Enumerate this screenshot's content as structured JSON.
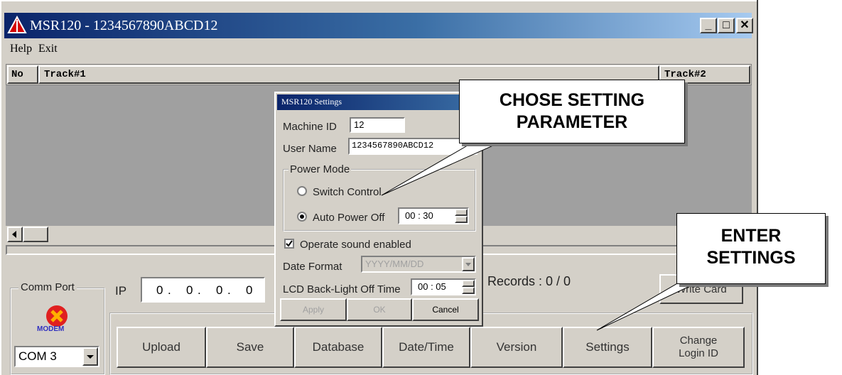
{
  "window": {
    "title": "MSR120 - 1234567890ABCD12",
    "controls": {
      "minimize": "_",
      "maximize": "□",
      "close": "✕"
    }
  },
  "menu": [
    "Help",
    "Exit"
  ],
  "list_headers": {
    "no": "No",
    "track1": "Track#1",
    "track2": "Track#2"
  },
  "comm_port": {
    "label": "Comm Port",
    "modem_label": "MODEM",
    "selected": "COM 3"
  },
  "ip": {
    "label": "IP",
    "octets": [
      "0",
      "0",
      "0",
      "0"
    ]
  },
  "records": "Records : 0 / 0",
  "write_card": "Write Card",
  "buttons": {
    "upload": "Upload",
    "save": "Save",
    "database": "Database",
    "datetime": "Date/Time",
    "version": "Version",
    "settings": "Settings",
    "change_login": "Change Login ID"
  },
  "dialog": {
    "title": "MSR120 Settings",
    "machine_id_label": "Machine ID",
    "machine_id": "12",
    "user_name_label": "User Name",
    "user_name": "1234567890ABCD12",
    "power_mode": {
      "legend": "Power Mode",
      "switch_control": "Switch Control",
      "auto_power_off": "Auto Power Off",
      "selected": "auto_power_off",
      "auto_off_time": "00 : 30"
    },
    "sound_label": "Operate sound enabled",
    "sound_checked": true,
    "date_format_label": "Date Format",
    "date_format": "YYYY/MM/DD",
    "lcd_label": "LCD Back-Light Off Time",
    "lcd_time": "00 : 05",
    "apply": "Apply",
    "ok": "OK",
    "cancel": "Cancel"
  },
  "callouts": {
    "chose": [
      "CHOSE SETTING",
      "PARAMETER"
    ],
    "enter": [
      "ENTER",
      "SETTINGS"
    ]
  },
  "colors": {
    "title_bar_start": "#0a246a",
    "title_bar_end": "#a6caf0",
    "window_face": "#d4d0c8",
    "list_background": "#a0a0a0",
    "app_icon": "#d40000"
  }
}
